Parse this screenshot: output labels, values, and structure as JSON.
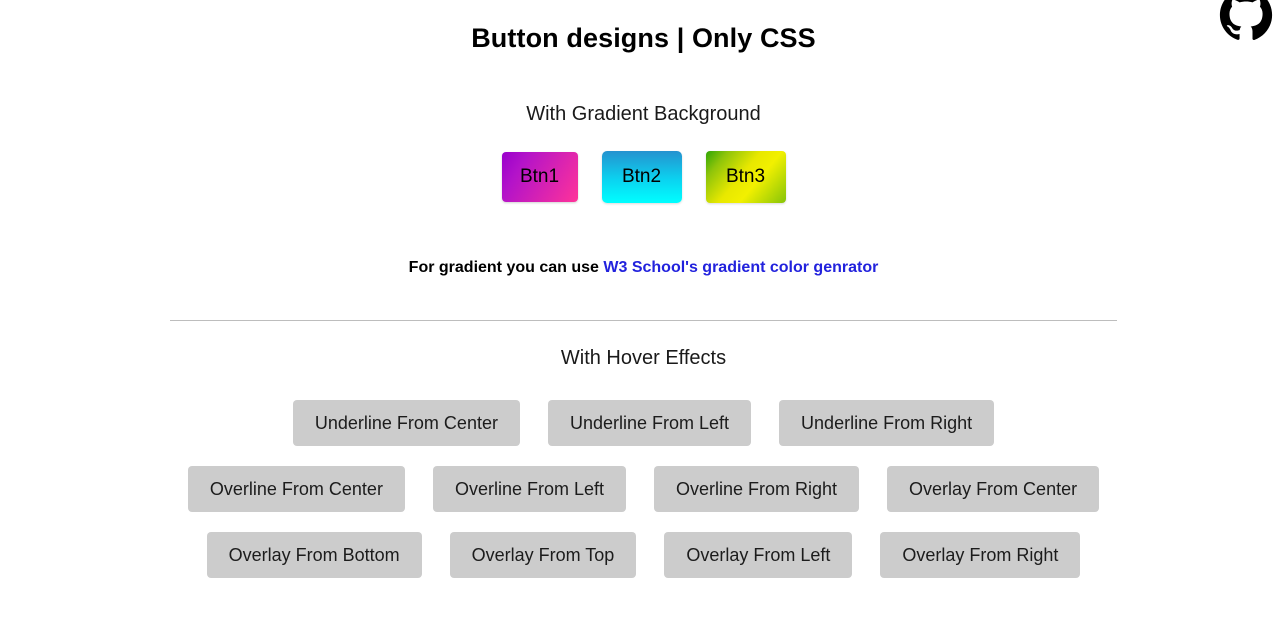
{
  "page": {
    "title": "Button designs | Only CSS",
    "background_color": "#ffffff"
  },
  "github_corner": {
    "icon": "github-octocat-icon",
    "color": "#000000"
  },
  "gradient_section": {
    "heading": "With Gradient Background",
    "buttons": [
      {
        "label": "Btn1",
        "gradient_from": "#9900cc",
        "gradient_to": "#ff3399"
      },
      {
        "label": "Btn2",
        "gradient_from": "#2592cf",
        "gradient_to": "#00ffff"
      },
      {
        "label": "Btn3",
        "gradient_from": "#2fa606",
        "gradient_to": "#f2f000"
      }
    ],
    "note_prefix": "For gradient you can use ",
    "note_link": "W3 School's gradient color genrator",
    "note_link_color": "#2222dd"
  },
  "hover_section": {
    "heading": "With Hover Effects",
    "button_color": "#cccccc",
    "rows": [
      {
        "buttons": [
          {
            "label": "Underline From Center"
          },
          {
            "label": "Underline From Left"
          },
          {
            "label": "Underline From Right"
          }
        ]
      },
      {
        "buttons": [
          {
            "label": "Overline From Center"
          },
          {
            "label": "Overline From Left"
          },
          {
            "label": "Overline From Right"
          },
          {
            "label": "Overlay From Center"
          }
        ]
      },
      {
        "buttons": [
          {
            "label": "Overlay From Bottom"
          },
          {
            "label": "Overlay From Top"
          },
          {
            "label": "Overlay From Left"
          },
          {
            "label": "Overlay From Right"
          }
        ]
      }
    ]
  }
}
